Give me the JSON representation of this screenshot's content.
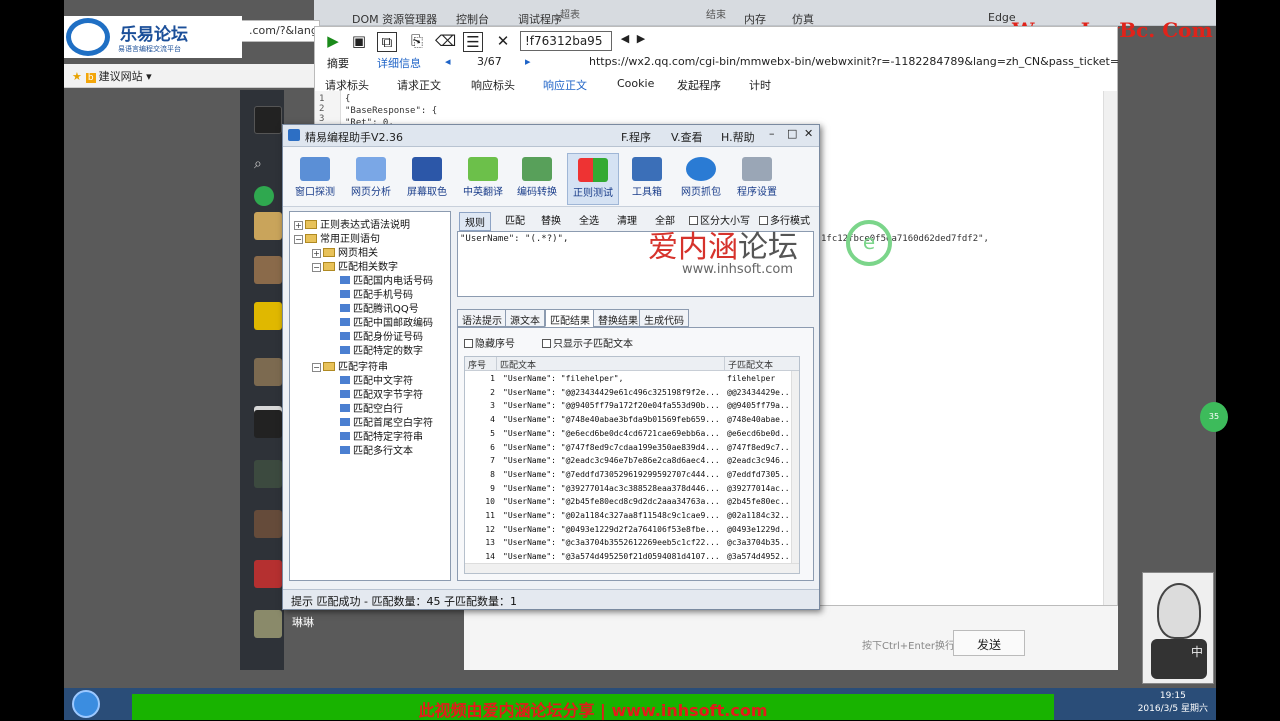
{
  "logos": {
    "forum_name": "乐易论坛",
    "forum_slogan": "易语言编程交流平台",
    "site_watermark": "Www. LeyBc. Com"
  },
  "browser": {
    "address_fragment": ".com/?&lang",
    "favorites_label": "建议网站",
    "toolbar_tabs": [
      "DOM 资源管理器",
      "控制台",
      "调试程序",
      "内存",
      "仿真"
    ],
    "toolbar_hint_tabs": [
      "超表",
      "结束"
    ],
    "engine_label": "Edge"
  },
  "devtools": {
    "filter_value": "!f76312ba95",
    "summary_label": "摘要",
    "detail_label": "详细信息",
    "counter": "3/67",
    "request_url": "https://wx2.qq.com/cgi-bin/mmwebx-bin/webwxinit?r=-1182284789&lang=zh_CN&pass_ticket=9SuezrPBAkigy7",
    "tabs": [
      "请求标头",
      "请求正文",
      "响应标头",
      "响应正文",
      "Cookie",
      "发起程序",
      "计时"
    ],
    "active_tab": "响应正文",
    "line_numbers": [
      "1",
      "2",
      "3"
    ],
    "code_lines": [
      "{",
      "\"BaseResponse\": {",
      "\"Ret\": 0,"
    ],
    "code_fragment": "1fc12fbce0f5ea7160d62ded7fdf2\","
  },
  "wechat": {
    "contact_name": "琳琳",
    "hint": "按下Ctrl+Enter换行",
    "send_label": "发送"
  },
  "helper": {
    "title": "精易编程助手V2.36",
    "menus": [
      "F.程序",
      "V.查看",
      "H.帮助"
    ],
    "tools": [
      "窗口探测",
      "网页分析",
      "屏幕取色",
      "中英翻译",
      "编码转换",
      "正则测试",
      "工具箱",
      "网页抓包",
      "程序设置"
    ],
    "active_tool": "正则测试",
    "tree": {
      "root1": "正则表达式语法说明",
      "root2": "常用正则语句",
      "group_web": "网页相关",
      "group_num": "匹配相关数字",
      "num_items": [
        "匹配国内电话号码",
        "匹配手机号码",
        "匹配腾讯QQ号",
        "匹配中国邮政编码",
        "匹配身份证号码",
        "匹配特定的数字"
      ],
      "group_str": "匹配字符串",
      "str_items": [
        "匹配中文字符",
        "匹配双字节字符",
        "匹配空白行",
        "匹配首尾空白字符",
        "匹配特定字符串",
        "匹配多行文本"
      ]
    },
    "regex_tabs": [
      "规则",
      "匹配",
      "替换",
      "全选",
      "清理",
      "全部"
    ],
    "option_case": "区分大小写",
    "option_multiline": "多行模式",
    "regex_text": "\"UserName\": \"(.*?)\",",
    "bottom_tabs": [
      "语法提示",
      "源文本",
      "匹配结果",
      "替换结果",
      "生成代码"
    ],
    "active_bottom_tab": "匹配结果",
    "option_hide_index": "隐藏序号",
    "option_only_sub": "只显示子匹配文本",
    "columns": [
      "序号",
      "匹配文本",
      "子匹配文本"
    ],
    "rows": [
      [
        "1",
        "\"UserName\": \"filehelper\",",
        "filehelper"
      ],
      [
        "2",
        "\"UserName\": \"@@23434429e61c496c325198f9f2e...",
        "@@23434429e..."
      ],
      [
        "3",
        "\"UserName\": \"@@9405ff79a172f20e04fa553d90b...",
        "@@9405ff79a..."
      ],
      [
        "4",
        "\"UserName\": \"@748e40abae3bfda9b01569feb659...",
        "@748e40abae..."
      ],
      [
        "5",
        "\"UserName\": \"@e6ecd6be0dc4cd6721cae69ebb6a...",
        "@e6ecd6be0d..."
      ],
      [
        "6",
        "\"UserName\": \"@747f8ed9c7cdaa199e350ae839d4...",
        "@747f8ed9c7..."
      ],
      [
        "7",
        "\"UserName\": \"@2eadc3c946e7b7e86e2ca8d6aec4...",
        "@2eadc3c946..."
      ],
      [
        "8",
        "\"UserName\": \"@7eddfd730529619299592707c444...",
        "@7eddfd7305..."
      ],
      [
        "9",
        "\"UserName\": \"@39277014ac3c388528eaa378d446...",
        "@39277014ac..."
      ],
      [
        "10",
        "\"UserName\": \"@2b45fe80ecd8c9d2dc2aaa34763a...",
        "@2b45fe80ec..."
      ],
      [
        "11",
        "\"UserName\": \"@02a1184c327aa8f11548c9c1cae9...",
        "@02a1184c32..."
      ],
      [
        "12",
        "\"UserName\": \"@0493e1229d2f2a764106f53e8fbe...",
        "@0493e1229d..."
      ],
      [
        "13",
        "\"UserName\": \"@c3a3704b3552612269eeb5c1cf22...",
        "@c3a3704b35..."
      ],
      [
        "14",
        "\"UserName\": \"@3a574d495250f21d0594081d4107...",
        "@3a574d4952..."
      ]
    ],
    "status": "提示 匹配成功 - 匹配数量：45  子匹配数量：1"
  },
  "watermark": {
    "text_red": "爱内涵",
    "text_gray": "论坛",
    "url": "www.inhsoft.com",
    "badge": "e"
  },
  "taskbar": {
    "banner": "此视频由爱内涵论坛分享 | www.inhsoft.com",
    "time": "19:15",
    "date": "2016/3/5 星期六",
    "bubble": "35",
    "girl_char": "中"
  }
}
